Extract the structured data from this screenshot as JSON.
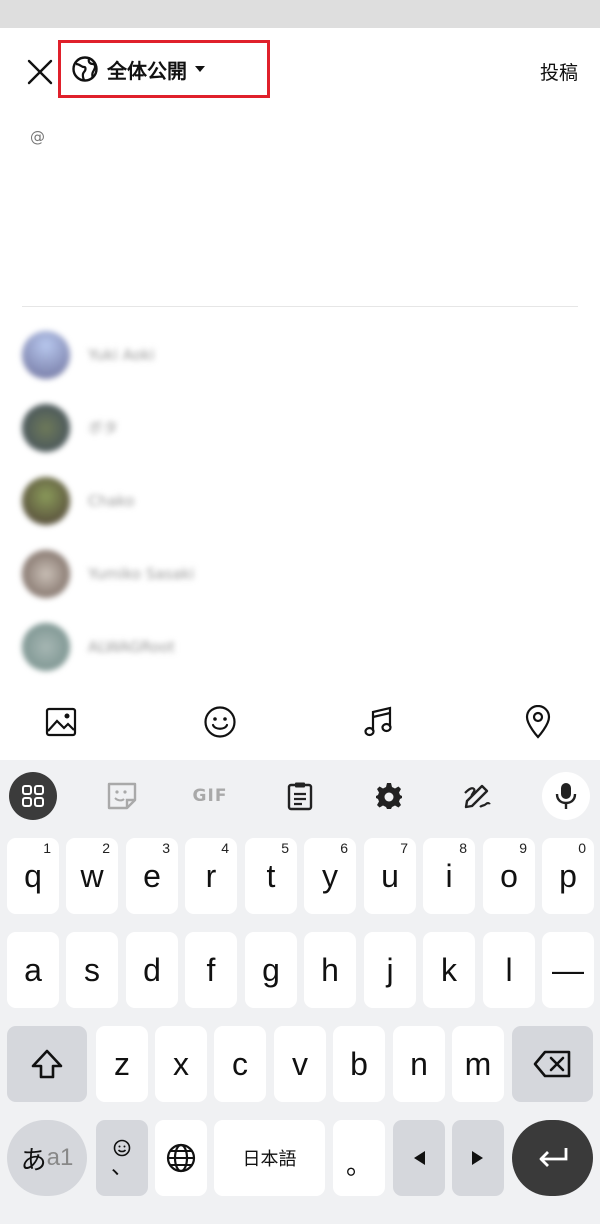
{
  "header": {
    "visibility_label": "全体公開",
    "post_label": "投稿"
  },
  "composer": {
    "mention_text": "@"
  },
  "suggestions": [
    {
      "name": "Yuki Aoki",
      "avatar_color": "#8fa7d6"
    },
    {
      "name": "ボタ",
      "avatar_color": "#5b6a5a"
    },
    {
      "name": "Chako",
      "avatar_color": "#6a5a4a"
    },
    {
      "name": "Yumiko Sasaki",
      "avatar_color": "#a39a93"
    },
    {
      "name": "ALWAGRoot",
      "avatar_color": "#8fa3a0"
    }
  ],
  "toolbar": {
    "icons": [
      "image-icon",
      "emoji-icon",
      "music-icon",
      "location-icon"
    ]
  },
  "keyboard": {
    "gif_label": "GIF",
    "row1": [
      {
        "key": "q",
        "hint": "1"
      },
      {
        "key": "w",
        "hint": "2"
      },
      {
        "key": "e",
        "hint": "3"
      },
      {
        "key": "r",
        "hint": "4"
      },
      {
        "key": "t",
        "hint": "5"
      },
      {
        "key": "y",
        "hint": "6"
      },
      {
        "key": "u",
        "hint": "7"
      },
      {
        "key": "i",
        "hint": "8"
      },
      {
        "key": "o",
        "hint": "9"
      },
      {
        "key": "p",
        "hint": "0"
      }
    ],
    "row2": [
      "a",
      "s",
      "d",
      "f",
      "g",
      "h",
      "j",
      "k",
      "l",
      "—"
    ],
    "row3": [
      "z",
      "x",
      "c",
      "v",
      "b",
      "n",
      "m"
    ],
    "lang_key": "日本語",
    "mode_key_main": "あ",
    "mode_key_sub": "a1",
    "punct_key": "。",
    "comma_key": "、"
  },
  "colors": {
    "highlight_border": "#e0202b",
    "keyboard_bg": "#f0f1f3"
  }
}
